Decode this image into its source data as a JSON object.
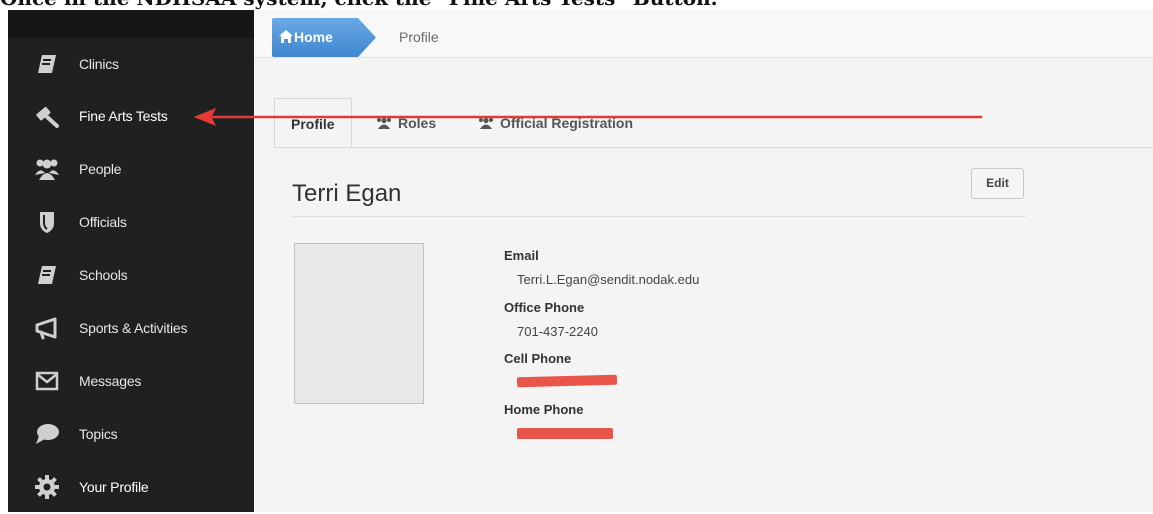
{
  "caption": "Once in the NDHSAA system, click the \"Fine Arts Tests\" Button.",
  "sidebar": {
    "items": [
      {
        "label": "Clinics",
        "icon": "book-icon"
      },
      {
        "label": "Fine Arts Tests",
        "icon": "gavel-icon"
      },
      {
        "label": "People",
        "icon": "group-icon"
      },
      {
        "label": "Officials",
        "icon": "shield-icon"
      },
      {
        "label": "Schools",
        "icon": "book-icon"
      },
      {
        "label": "Sports & Activities",
        "icon": "megaphone-icon"
      },
      {
        "label": "Messages",
        "icon": "envelope-icon"
      },
      {
        "label": "Topics",
        "icon": "speech-bubble-icon"
      },
      {
        "label": "Your Profile",
        "icon": "gear-icon"
      }
    ]
  },
  "breadcrumb": {
    "home": "Home",
    "current": "Profile"
  },
  "tabs": [
    "Profile",
    "Roles",
    "Official Registration"
  ],
  "profile": {
    "name": "Terri Egan",
    "edit_label": "Edit",
    "email_label": "Email",
    "email": "Terri.L.Egan@sendit.nodak.edu",
    "office_phone_label": "Office Phone",
    "office_phone": "701-437-2240",
    "cell_phone_label": "Cell Phone",
    "home_phone_label": "Home Phone"
  },
  "colors": {
    "sidebar_bg": "#1e2022",
    "breadcrumb_home": "#4a90d9",
    "annotation_arrow": "#e53935",
    "redaction": "#e8554a"
  }
}
